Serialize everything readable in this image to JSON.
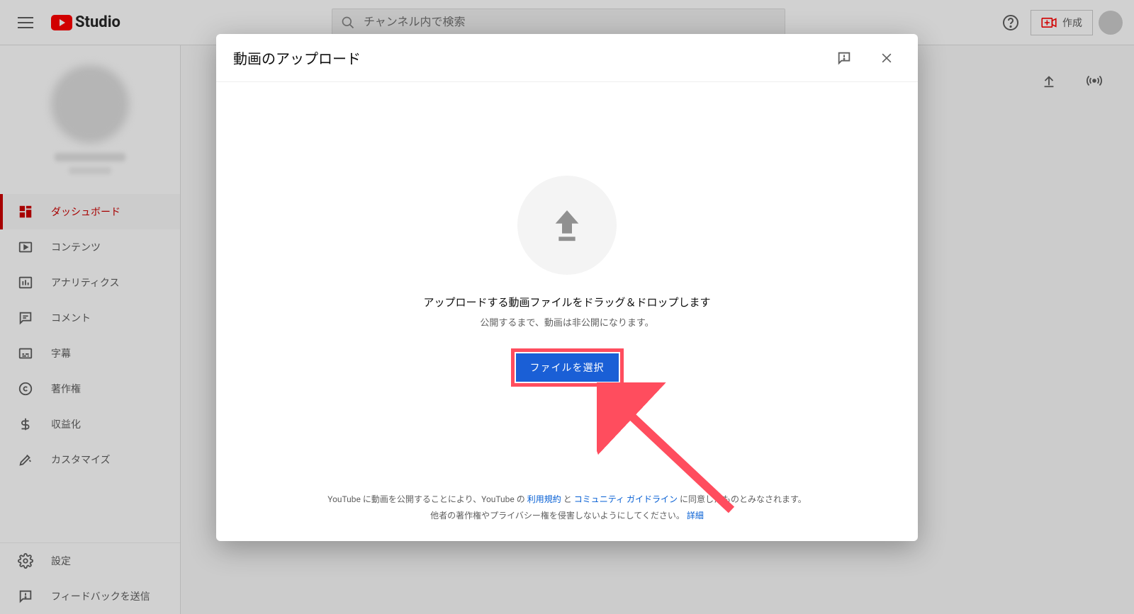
{
  "header": {
    "logo_text": "Studio",
    "search_placeholder": "チャンネル内で検索",
    "create_label": "作成"
  },
  "sidebar": {
    "items": [
      {
        "label": "ダッシュボード",
        "icon": "dashboard-icon",
        "active": true
      },
      {
        "label": "コンテンツ",
        "icon": "content-icon",
        "active": false
      },
      {
        "label": "アナリティクス",
        "icon": "analytics-icon",
        "active": false
      },
      {
        "label": "コメント",
        "icon": "comments-icon",
        "active": false
      },
      {
        "label": "字幕",
        "icon": "subtitles-icon",
        "active": false
      },
      {
        "label": "著作権",
        "icon": "copyright-icon",
        "active": false
      },
      {
        "label": "収益化",
        "icon": "monetization-icon",
        "active": false
      },
      {
        "label": "カスタマイズ",
        "icon": "customize-icon",
        "active": false
      }
    ],
    "bottom": [
      {
        "label": "設定",
        "icon": "settings-icon"
      },
      {
        "label": "フィードバックを送信",
        "icon": "feedback-icon"
      }
    ]
  },
  "modal": {
    "title": "動画のアップロード",
    "drag_msg": "アップロードする動画ファイルをドラッグ＆ドロップします",
    "private_msg": "公開するまで、動画は非公開になります。",
    "select_label": "ファイルを選択",
    "footer_line1_pre": "YouTube に動画を公開することにより、YouTube の",
    "footer_link_tos": "利用規約",
    "footer_line1_mid": "と",
    "footer_link_guidelines": "コミュニティ ガイドライン",
    "footer_line1_post": "に同意したものとみなされます。",
    "footer_line2_pre": "他者の著作権やプライバシー権を侵害しないようにしてください。",
    "footer_link_more": "詳細"
  }
}
